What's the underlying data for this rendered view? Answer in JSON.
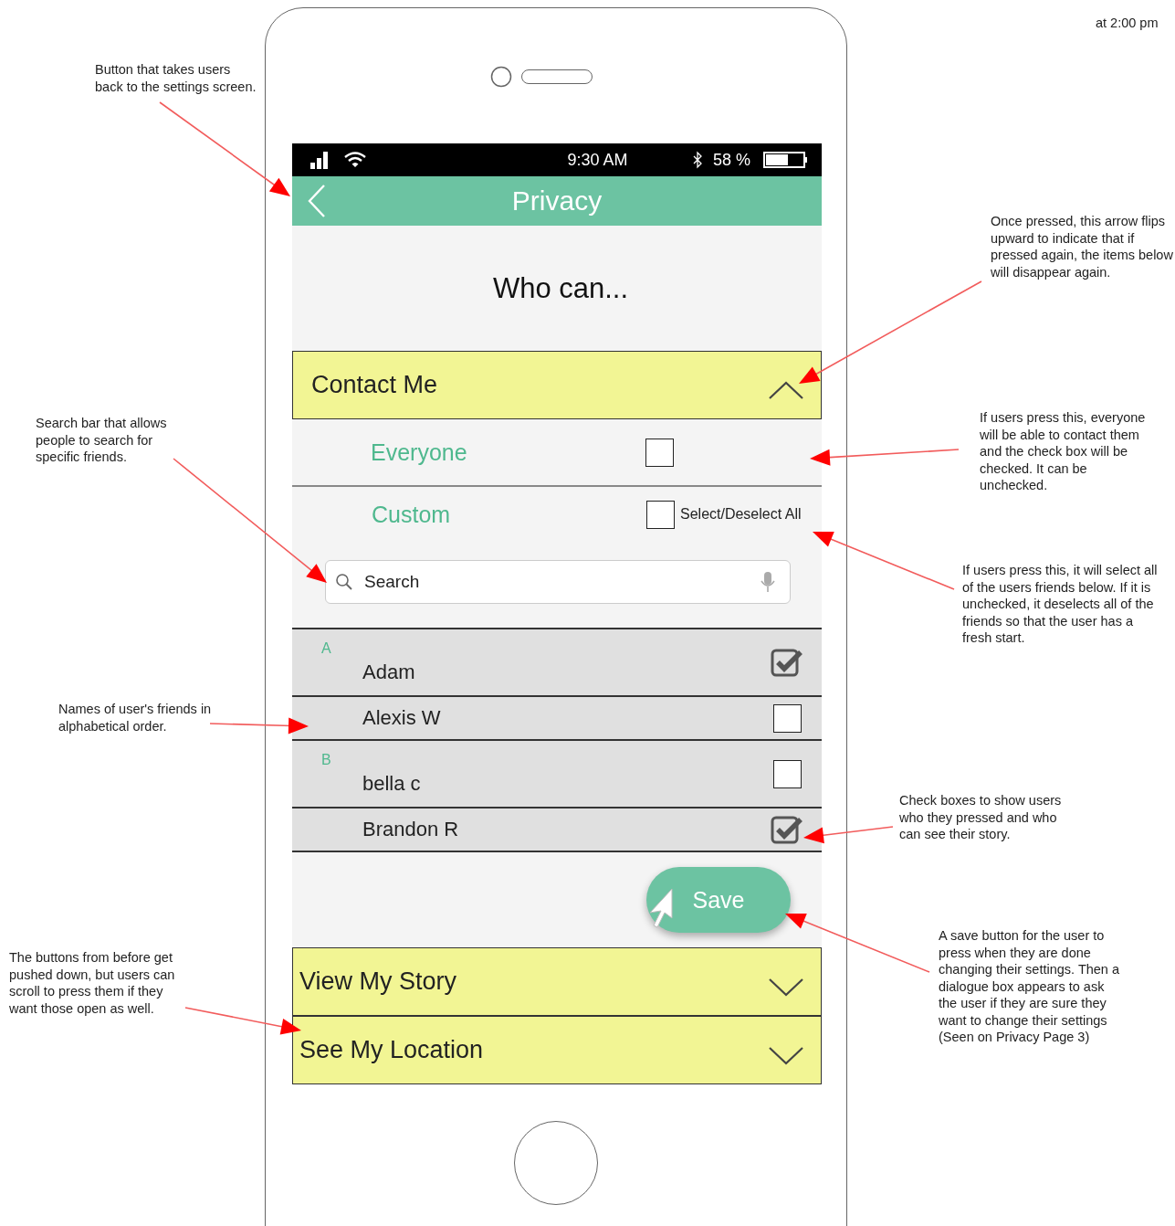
{
  "note": "at 2:00 pm",
  "annotations": [
    {
      "text": "Button that takes users back to the settings screen."
    },
    {
      "text": "Once pressed, this arrow flips upward to indicate that if pressed again, the items below will disappear again."
    },
    {
      "text": "Search bar that allows people to search for specific friends."
    },
    {
      "text": "If users press this, everyone will be able to contact them and the check box will be checked. It can be unchecked."
    },
    {
      "text": "If users press this, it will select all of the users friends below. If it is unchecked, it deselects all of the friends so that the user has a fresh start."
    },
    {
      "text": "Names of user's friends in alphabetical order."
    },
    {
      "text": "Check boxes to show users who they pressed and who can see their story."
    },
    {
      "text": "The buttons from before get pushed down, but users can scroll to press them if they want those open as well."
    },
    {
      "text": "A save button for the user to press when they are done changing their settings. Then a dialogue box appears to ask the user if they are sure they want to change their settings (Seen on Privacy Page 3)"
    }
  ],
  "status_bar": {
    "time": "9:30 AM",
    "battery": "58 %"
  },
  "header": {
    "title": "Privacy"
  },
  "prompt": "Who can...",
  "contact_me": {
    "title": "Contact Me",
    "expanded": true,
    "everyone": {
      "label": "Everyone",
      "checked": false
    },
    "custom": {
      "label": "Custom",
      "select_all": {
        "label": "Select/Deselect All",
        "checked": false
      },
      "search": {
        "placeholder": "Search"
      }
    },
    "groups": [
      {
        "letter": "A",
        "friends": [
          {
            "name": "Adam",
            "checked": true
          },
          {
            "name": "Alexis W",
            "checked": false
          }
        ]
      },
      {
        "letter": "B",
        "friends": [
          {
            "name": "bella c",
            "checked": false
          },
          {
            "name": "Brandon R",
            "checked": true
          }
        ]
      }
    ],
    "save": "Save"
  },
  "other_sections": [
    {
      "title": "View My Story",
      "expanded": false
    },
    {
      "title": "See My Location",
      "expanded": false
    }
  ]
}
